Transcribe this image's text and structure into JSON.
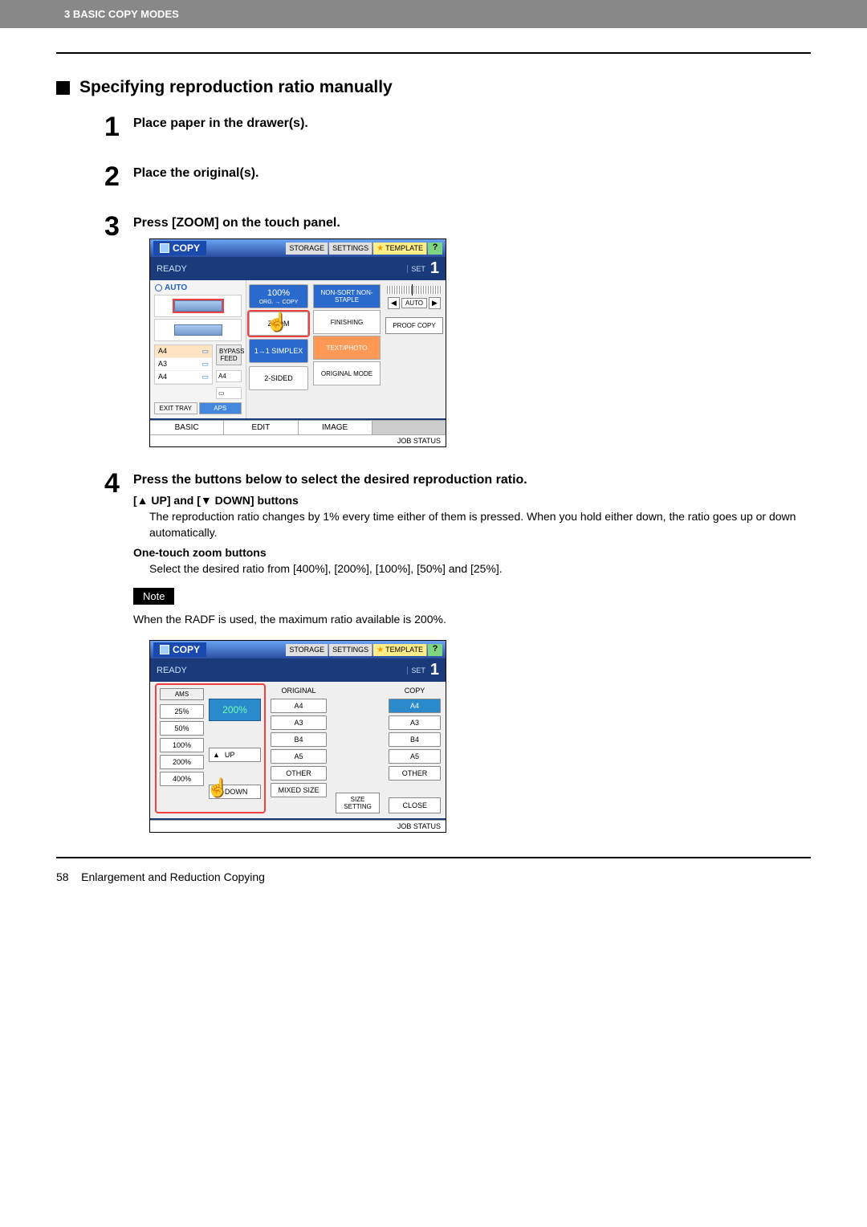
{
  "header": {
    "chapter": "3 BASIC COPY MODES"
  },
  "section": {
    "title": "Specifying reproduction ratio manually"
  },
  "steps": {
    "s1": {
      "num": "1",
      "title": "Place paper in the drawer(s)."
    },
    "s2": {
      "num": "2",
      "title": "Place the original(s)."
    },
    "s3": {
      "num": "3",
      "title": "Press [ZOOM] on the touch panel."
    },
    "s4": {
      "num": "4",
      "title": "Press the buttons below to select the desired reproduction ratio.",
      "sub1_label": "[▲ UP] and [▼ DOWN] buttons",
      "sub1_text": "The reproduction ratio changes by 1% every time either of them is pressed. When you hold either down, the ratio goes up or down automatically.",
      "sub2_label": "One-touch zoom buttons",
      "sub2_text": "Select the desired ratio from [400%], [200%], [100%], [50%] and [25%].",
      "note_label": "Note",
      "note_text": "When the RADF is used, the maximum ratio available is 200%."
    }
  },
  "panel1": {
    "copy": "COPY",
    "storage": "STORAGE",
    "settings": "SETTINGS",
    "template": "TEMPLATE",
    "help": "?",
    "ready": "READY",
    "set": "SET",
    "count": "1",
    "auto": "AUTO",
    "sizes": {
      "a4_top": "A4",
      "a3": "A3",
      "a4_mid": "A4",
      "a4_b": "A4",
      "a4_side": "A4"
    },
    "bypass": "BYPASS FEED",
    "exit_tray": "EXIT TRAY",
    "aps": "APS",
    "mid": {
      "pct": "100%",
      "org_copy": "ORG. → COPY",
      "zoom": "ZOOM",
      "simplex": "1→1 SIMPLEX",
      "two_sided": "2-SIDED"
    },
    "right": {
      "nonsort": "NON-SORT NON-STAPLE",
      "finishing": "FINISHING",
      "textphoto": "TEXT/PHOTO",
      "orig_mode": "ORIGINAL MODE"
    },
    "far": {
      "auto": "AUTO",
      "proof": "PROOF COPY"
    },
    "tabs": {
      "basic": "BASIC",
      "edit": "EDIT",
      "image": "IMAGE"
    },
    "jobstatus": "JOB STATUS"
  },
  "panel2": {
    "ams": "AMS",
    "pct": "200%",
    "ratios": [
      "25%",
      "50%",
      "100%",
      "200%",
      "400%"
    ],
    "up": "UP",
    "down": "DOWN",
    "orig_head": "ORIGINAL",
    "copy_head": "COPY",
    "orig_sizes": [
      "A4",
      "A3",
      "B4",
      "A5",
      "OTHER"
    ],
    "copy_sizes": [
      "A4",
      "A3",
      "B4",
      "A5",
      "OTHER"
    ],
    "mixed": "MIXED SIZE",
    "size_setting": "SIZE SETTING",
    "close": "CLOSE"
  },
  "footer": {
    "page": "58",
    "title": "Enlargement and Reduction Copying"
  }
}
